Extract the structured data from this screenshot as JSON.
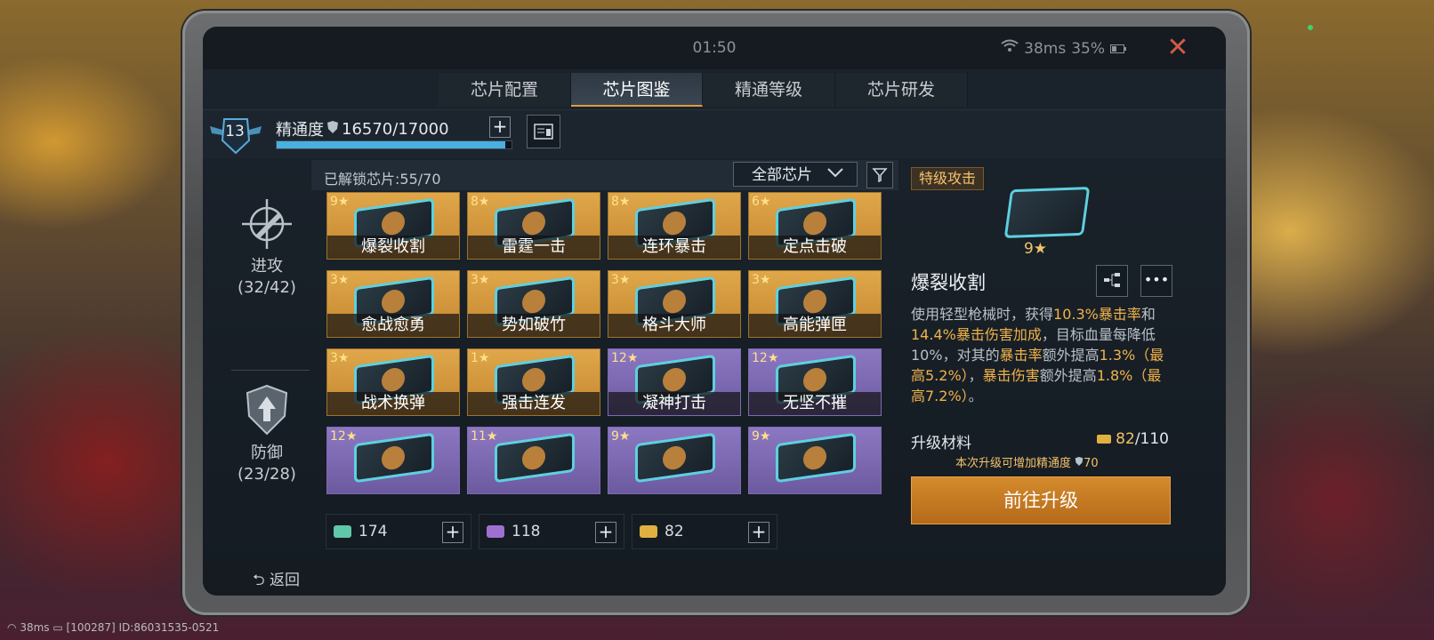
{
  "topbar": {
    "time": "01:50",
    "ping": "38ms",
    "battery": "35%"
  },
  "tabs": [
    "芯片配置",
    "芯片图鉴",
    "精通等级",
    "芯片研发"
  ],
  "active_tab": 1,
  "mastery": {
    "level": "13",
    "label": "精通度",
    "value": "16570/17000",
    "progress": 0.975
  },
  "sidebar": {
    "attack": {
      "label": "进攻",
      "count": "(32/42)"
    },
    "defense": {
      "label": "防御",
      "count": "(23/28)"
    }
  },
  "list": {
    "unlocked": "已解锁芯片:55/70",
    "filter": "全部芯片"
  },
  "chips": [
    {
      "stars": "9",
      "name": "爆裂收割",
      "color": "gold"
    },
    {
      "stars": "8",
      "name": "雷霆一击",
      "color": "gold"
    },
    {
      "stars": "8",
      "name": "连环暴击",
      "color": "gold"
    },
    {
      "stars": "6",
      "name": "定点击破",
      "color": "gold"
    },
    {
      "stars": "3",
      "name": "愈战愈勇",
      "color": "gold"
    },
    {
      "stars": "3",
      "name": "势如破竹",
      "color": "gold"
    },
    {
      "stars": "3",
      "name": "格斗大师",
      "color": "gold"
    },
    {
      "stars": "3",
      "name": "高能弹匣",
      "color": "gold"
    },
    {
      "stars": "3",
      "name": "战术换弹",
      "color": "gold"
    },
    {
      "stars": "1",
      "name": "强击连发",
      "color": "gold"
    },
    {
      "stars": "12",
      "name": "凝神打击",
      "color": "purple"
    },
    {
      "stars": "12",
      "name": "无坚不摧",
      "color": "purple"
    },
    {
      "stars": "12",
      "name": "",
      "color": "purple"
    },
    {
      "stars": "11",
      "name": "",
      "color": "purple"
    },
    {
      "stars": "9",
      "name": "",
      "color": "purple"
    },
    {
      "stars": "9",
      "name": "",
      "color": "purple"
    }
  ],
  "resources": [
    {
      "value": "174",
      "color": "#5ec8a8"
    },
    {
      "value": "118",
      "color": "#a070d0"
    },
    {
      "value": "82",
      "color": "#e0b040"
    }
  ],
  "detail": {
    "rarity": "特级攻击",
    "stars": "9",
    "name": "爆裂收割",
    "desc": [
      {
        "t": "使用轻型枪械时，获得",
        "h": false
      },
      {
        "t": "10.3%暴击率",
        "h": true
      },
      {
        "t": "和",
        "h": false
      },
      {
        "t": "14.4%暴击伤害加成",
        "h": true
      },
      {
        "t": "，目标血量每降低10%，对其的",
        "h": false
      },
      {
        "t": "暴击率",
        "h": true
      },
      {
        "t": "额外提高",
        "h": false
      },
      {
        "t": "1.3%（最高5.2%）",
        "h": true
      },
      {
        "t": "，",
        "h": false
      },
      {
        "t": "暴击伤害",
        "h": true
      },
      {
        "t": "额外提高",
        "h": false
      },
      {
        "t": "1.8%（最高7.2%）",
        "h": true
      },
      {
        "t": "。",
        "h": false
      }
    ],
    "material_label": "升级材料",
    "material_current": "82",
    "material_total": "/110",
    "hint_prefix": "本次升级可增加精通度",
    "hint_value": "70",
    "upgrade_label": "前往升级"
  },
  "back_label": "返回",
  "system": {
    "ping": "38ms",
    "info": "[100287] ID:86031535-0521"
  }
}
